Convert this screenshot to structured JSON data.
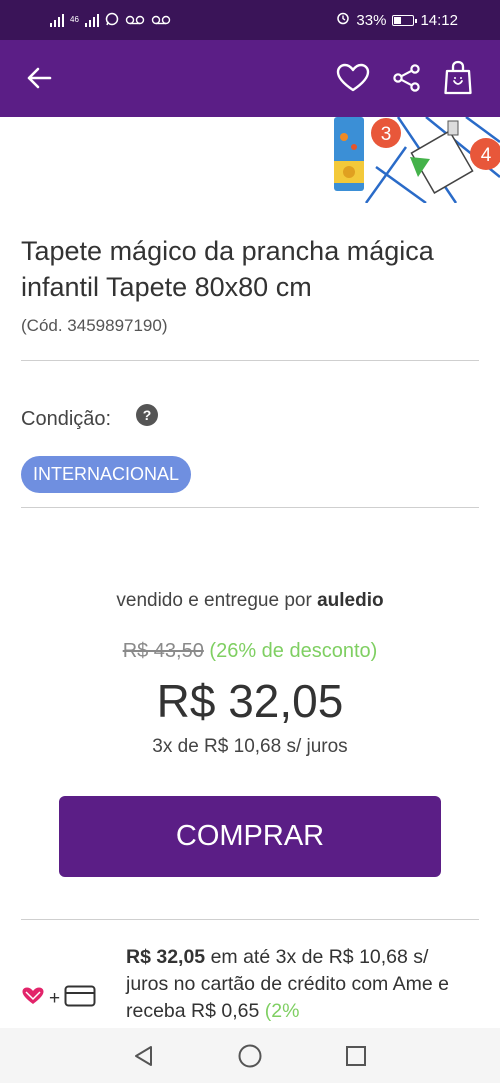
{
  "status_bar": {
    "network_tag": "46",
    "battery_percent": "33%",
    "battery_level": 0.33,
    "time": "14:12"
  },
  "header": {
    "back_icon": "arrow-left-icon",
    "favorite_icon": "heart-outline-icon",
    "share_icon": "share-icon",
    "cart_icon": "shopping-bag-icon",
    "background_color": "#5b1e86"
  },
  "product": {
    "title": "Tapete mágico da prancha mágica infantil Tapete 80x80 cm",
    "code": "(Cód. 3459897190)",
    "image_step_numbers": [
      "3",
      "4"
    ]
  },
  "condition": {
    "label": "Condição:",
    "help_symbol": "?",
    "value": "INTERNACIONAL"
  },
  "offer": {
    "sold_by_prefix": "vendido e entregue por",
    "seller": "auledio",
    "old_price": "R$ 43,50",
    "discount": "(26% de desconto)",
    "price": "R$ 32,05",
    "installments": "3x de R$ 10,68 s/ juros",
    "buy_label": "COMPRAR"
  },
  "ame": {
    "price": "R$ 32,05",
    "text": " em até 3x de R$ 10,68 s/ juros no cartão de crédito com Ame e receba R$ 0,65 ",
    "cashback_percent": "(2%",
    "icons": [
      "ame-heart-icon",
      "plus-icon",
      "credit-card-icon"
    ]
  },
  "nav_bar": {
    "buttons": [
      "back-triangle-icon",
      "home-circle-icon",
      "recents-square-icon"
    ]
  },
  "colors": {
    "brand_purple": "#5b1e86",
    "chip_blue": "#6f8fe0",
    "discount_green": "#7fcf62"
  }
}
